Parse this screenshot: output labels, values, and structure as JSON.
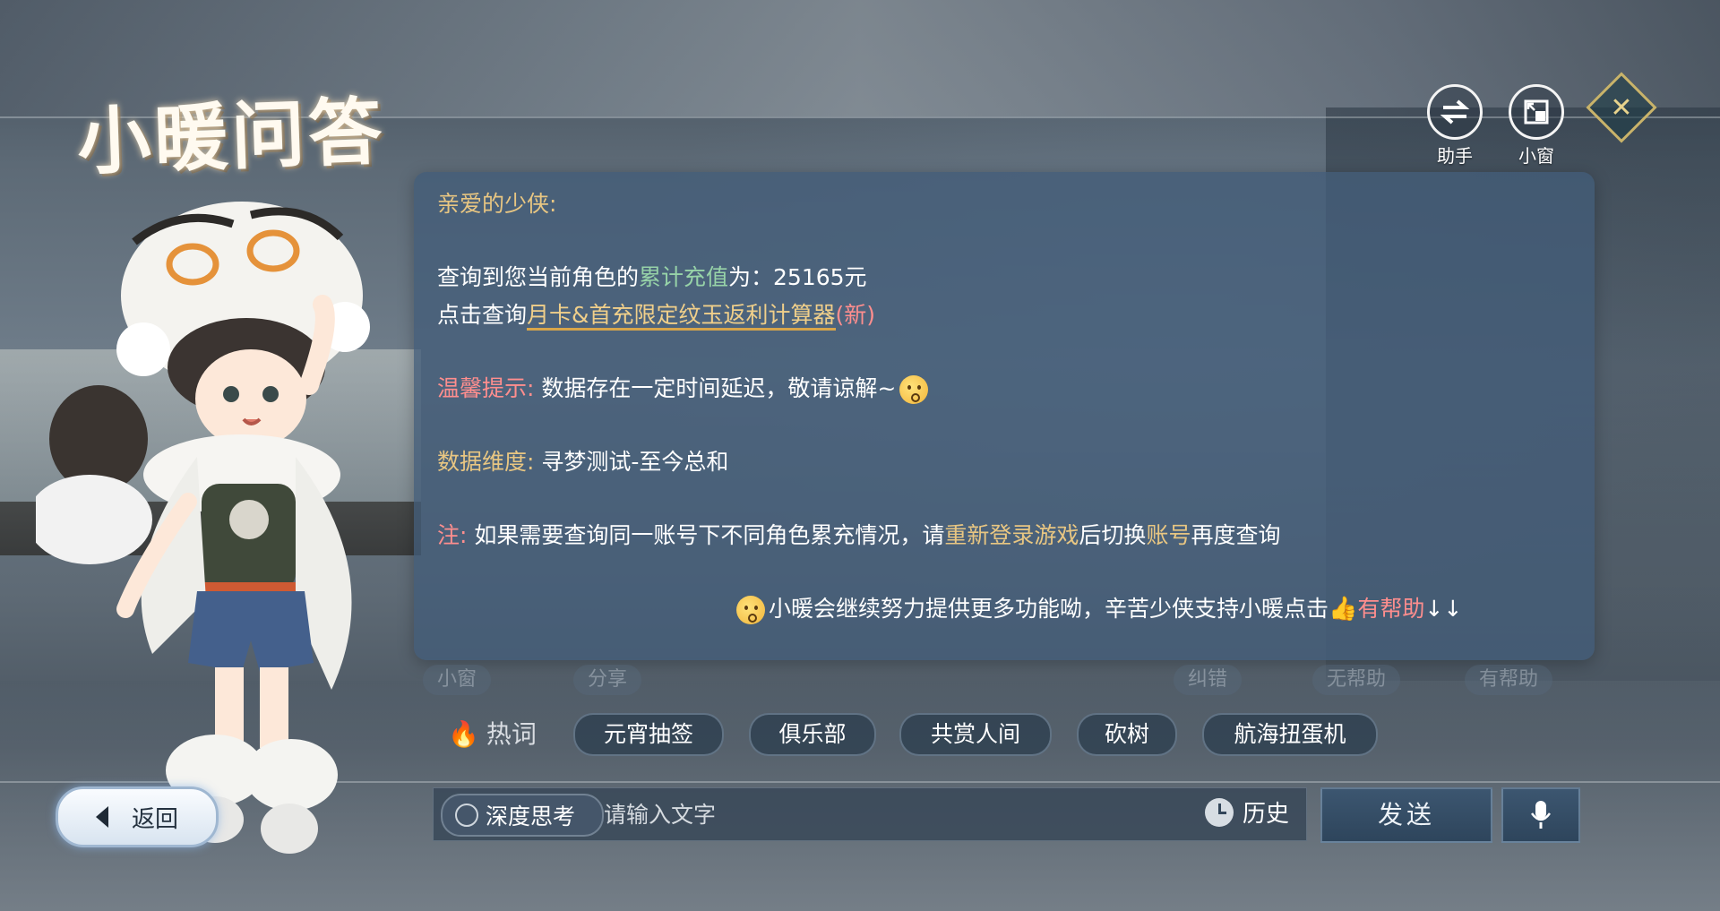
{
  "title": "小暖问答",
  "top_buttons": {
    "assistant": "助手",
    "mini_window": "小窗"
  },
  "message": {
    "greeting": "亲爱的少侠:",
    "query_prefix": "查询到您当前角色的",
    "query_highlight": "累计充值",
    "query_suffix": "为：25165元",
    "link_prefix": "点击查询",
    "link_text": "月卡&首充限定纹玉返利计算器",
    "link_new": "(新)",
    "tip_label": "温馨提示:",
    "tip_text": "数据存在一定时间延迟，敬请谅解~",
    "dim_label": "数据维度:",
    "dim_text": "寻梦测试-至今总和",
    "note_label": "注:",
    "note_text_a": "如果需要查询同一账号下不同角色累充情况，请",
    "note_highlight_a": "重新登录游戏",
    "note_text_b": "后切换",
    "note_highlight_b": "账号",
    "note_text_c": "再度查询",
    "closing_text": "小暖会继续努力提供更多功能呦，辛苦少侠支持小暖点击",
    "closing_helpful": "有帮助",
    "closing_arrows": "↓↓"
  },
  "faded_actions": [
    "小窗",
    "分享",
    "纠错",
    "无帮助",
    "有帮助"
  ],
  "hot_words": {
    "label": "热词",
    "items": [
      "元宵抽签",
      "俱乐部",
      "共赏人间",
      "砍树",
      "航海扭蛋机"
    ]
  },
  "bottom": {
    "back_label": "返回",
    "deep_think_label": "深度思考",
    "input_placeholder": "请输入文字",
    "history_label": "历史",
    "send_label": "发送"
  },
  "colors": {
    "panel_bg": "#425c78",
    "gold": "#e8c682",
    "green": "#97d3a8",
    "red": "#ff8e8e"
  }
}
